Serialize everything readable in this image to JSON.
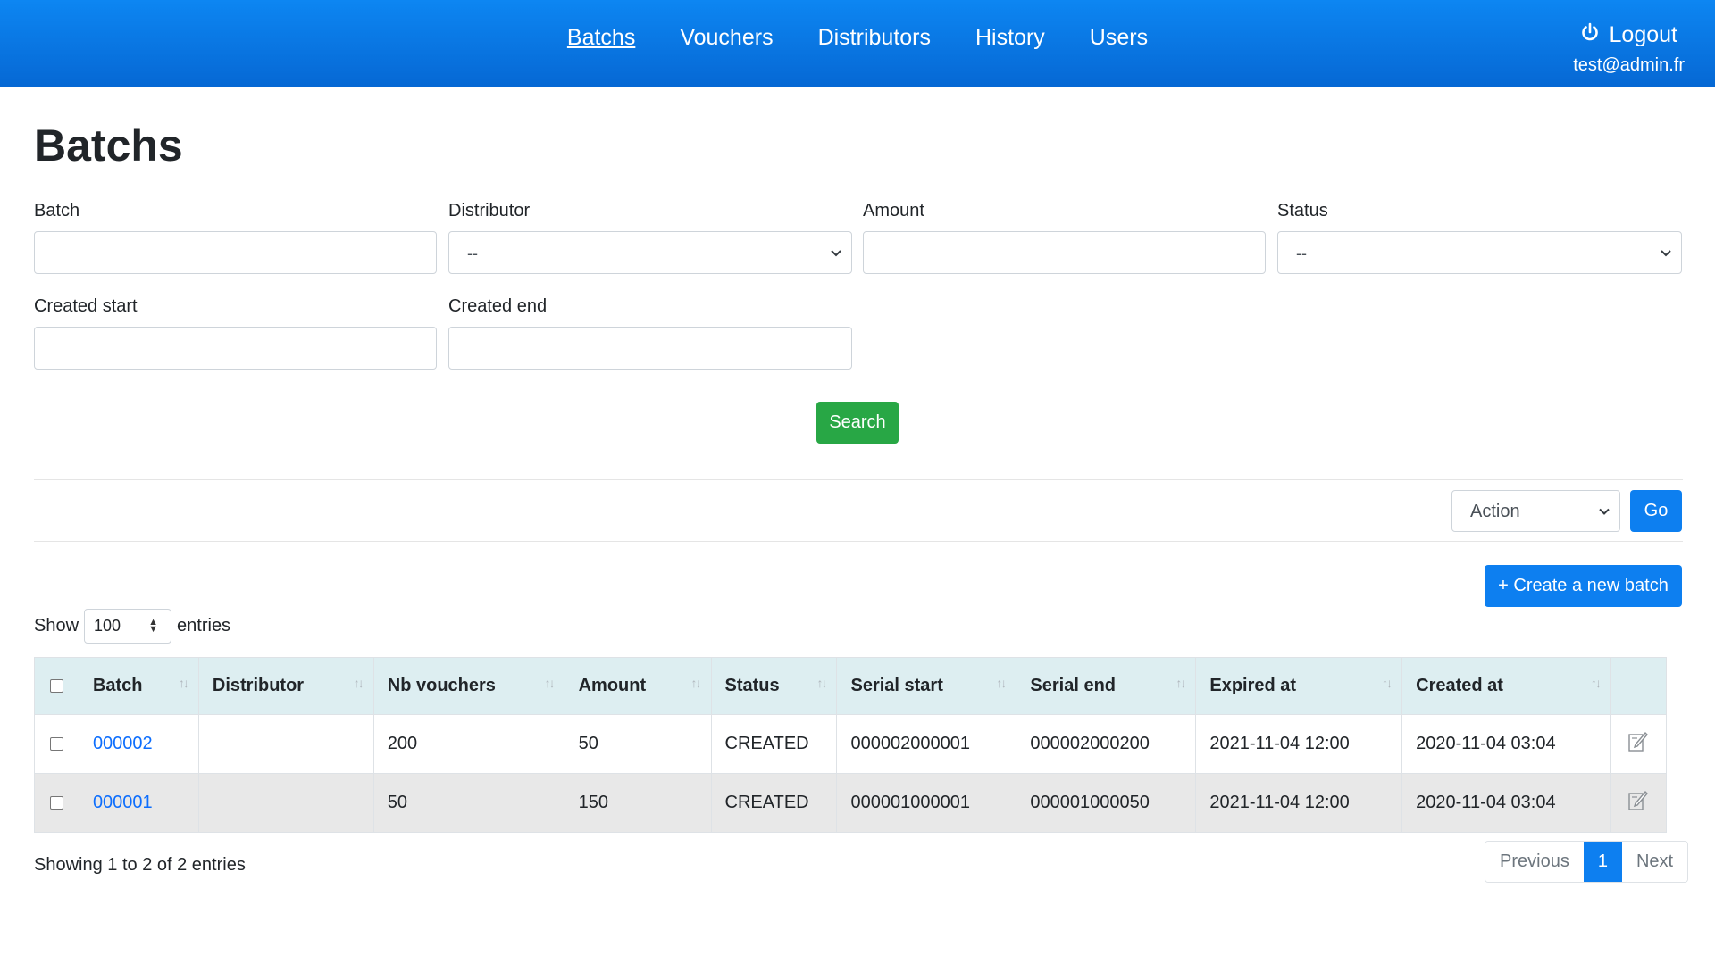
{
  "nav": {
    "links": [
      "Batchs",
      "Vouchers",
      "Distributors",
      "History",
      "Users"
    ],
    "logout": "Logout",
    "user_email": "test@admin.fr"
  },
  "page": {
    "title": "Batchs"
  },
  "filters": {
    "batch_label": "Batch",
    "batch_value": "",
    "distributor_label": "Distributor",
    "distributor_value": "--",
    "amount_label": "Amount",
    "amount_value": "",
    "status_label": "Status",
    "status_value": "--",
    "created_start_label": "Created start",
    "created_start_value": "",
    "created_end_label": "Created end",
    "created_end_value": "",
    "search_button": "Search"
  },
  "actions": {
    "action_select": "Action",
    "go_button": "Go",
    "create_button": "+ Create a new batch"
  },
  "listing": {
    "show_label": "Show",
    "length_value": "100",
    "entries_label": "entries",
    "columns": [
      "Batch",
      "Distributor",
      "Nb vouchers",
      "Amount",
      "Status",
      "Serial start",
      "Serial end",
      "Expired at",
      "Created at"
    ],
    "rows": [
      {
        "batch": "000002",
        "distributor": "",
        "nb_vouchers": "200",
        "amount": "50",
        "status": "CREATED",
        "serial_start": "000002000001",
        "serial_end": "000002000200",
        "expired_at": "2021-11-04 12:00",
        "created_at": "2020-11-04 03:04"
      },
      {
        "batch": "000001",
        "distributor": "",
        "nb_vouchers": "50",
        "amount": "150",
        "status": "CREATED",
        "serial_start": "000001000001",
        "serial_end": "000001000050",
        "expired_at": "2021-11-04 12:00",
        "created_at": "2020-11-04 03:04"
      }
    ],
    "info": "Showing 1 to 2 of 2 entries"
  },
  "pagination": {
    "previous": "Previous",
    "current": "1",
    "next": "Next"
  },
  "colors": {
    "navbar": "#0668d4",
    "primary": "#0d7ff0",
    "success": "#28a745",
    "table_header": "#ddeef1"
  }
}
